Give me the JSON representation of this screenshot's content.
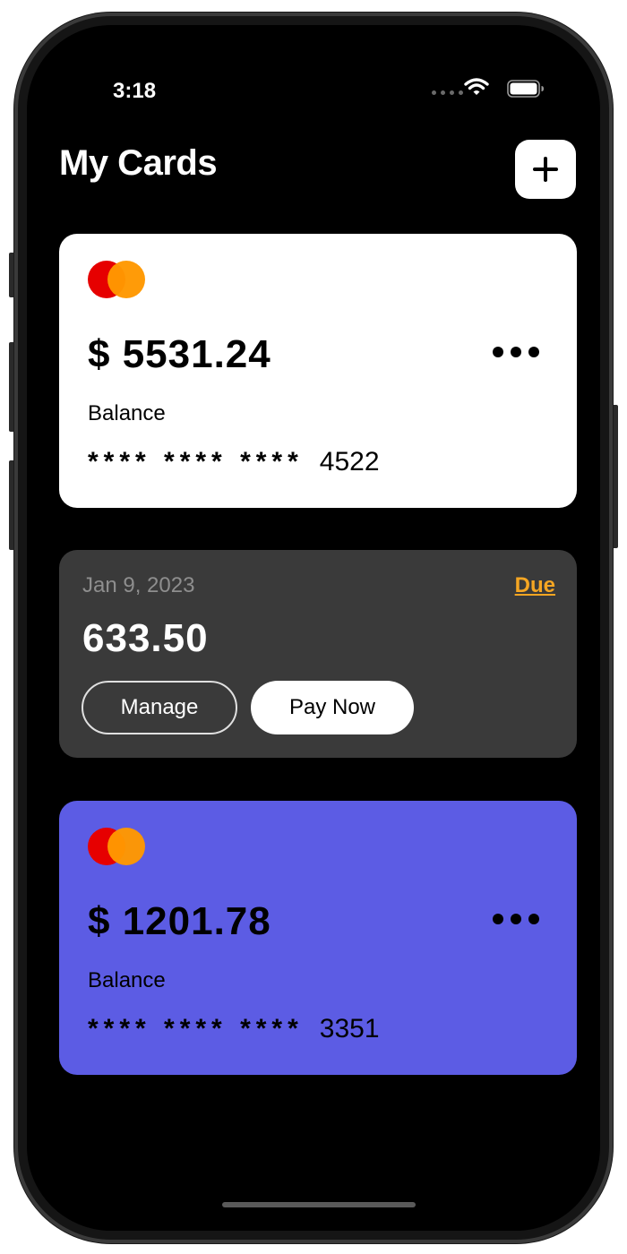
{
  "status_bar": {
    "time": "3:18"
  },
  "header": {
    "title": "My Cards",
    "add_icon": "plus-icon"
  },
  "cards": [
    {
      "amount": "$ 5531.24",
      "balance_label": "Balance",
      "masked": "**** **** ****",
      "last4": "4522",
      "background": "#ffffff",
      "logo": "mastercard-logo",
      "more_icon": "more-horizontal-icon"
    },
    {
      "amount": "$ 1201.78",
      "balance_label": "Balance",
      "masked": "**** **** ****",
      "last4": "3351",
      "background": "#5c5ce4",
      "logo": "mastercard-logo",
      "more_icon": "more-horizontal-icon"
    }
  ],
  "bill": {
    "date": "Jan 9, 2023",
    "due_label": "Due",
    "amount": "633.50",
    "manage_label": "Manage",
    "pay_label": "Pay Now",
    "background": "#3a3a3a",
    "due_color": "#f5a623"
  }
}
